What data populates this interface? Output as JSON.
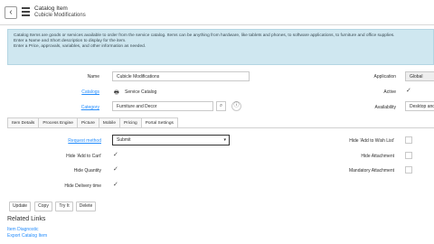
{
  "header": {
    "title": "Catalog Item",
    "subtitle": "Cubicle Modifications",
    "back_symbol": "‹",
    "back_icon": "chevron-left-icon",
    "menu_icon": "hamburger-menu-icon"
  },
  "info_lines": [
    "Catalog Items are goods or services available to order from the service catalog. Items can be anything from hardware, like tablets and phones, to software applications, to furniture and office supplies.",
    "Enter a Name and Short description to display for the item.",
    "Enter a Price, approvals, variables, and other information as needed."
  ],
  "form": {
    "name_label": "Name",
    "name_value": "Cubicle Modifications",
    "catalogs_label": "Catalogs",
    "catalogs_value": "Service Catalog",
    "category_label": "Category",
    "category_value": "Furniture and Decor",
    "application_label": "Application",
    "application_value": "Global",
    "active_label": "Active",
    "availability_label": "Availability",
    "availability_value": "Desktop and"
  },
  "tabs": [
    "Item Details",
    "Process Engine",
    "Picture",
    "Mobile",
    "Pricing",
    "Portal Settings"
  ],
  "active_tab": "Portal Settings",
  "portal": {
    "request_method_label": "Request method",
    "request_method_value": "Submit",
    "hide_add_to_cart_label": "Hide 'Add to Cart'",
    "hide_quantity_label": "Hide Quantity",
    "hide_delivery_time_label": "Hide Delivery time",
    "hide_add_to_wish_list_label": "Hide 'Add to Wish List'",
    "hide_attachment_label": "Hide Attachment",
    "mandatory_attachment_label": "Mandatory Attachment"
  },
  "buttons": {
    "update": "Update",
    "copy": "Copy",
    "try_it": "Try It",
    "delete": "Delete"
  },
  "related": {
    "title": "Related Links",
    "links": [
      "Item Diagnostic",
      "Export Catalog Item"
    ]
  },
  "glyphs": {
    "check": "✓",
    "caret": "▾",
    "search": "⌕",
    "info": "ⓘ",
    "catalog_icon": "🖶"
  },
  "colors": {
    "info_bg": "#cfe7f0",
    "link": "#278efc"
  }
}
